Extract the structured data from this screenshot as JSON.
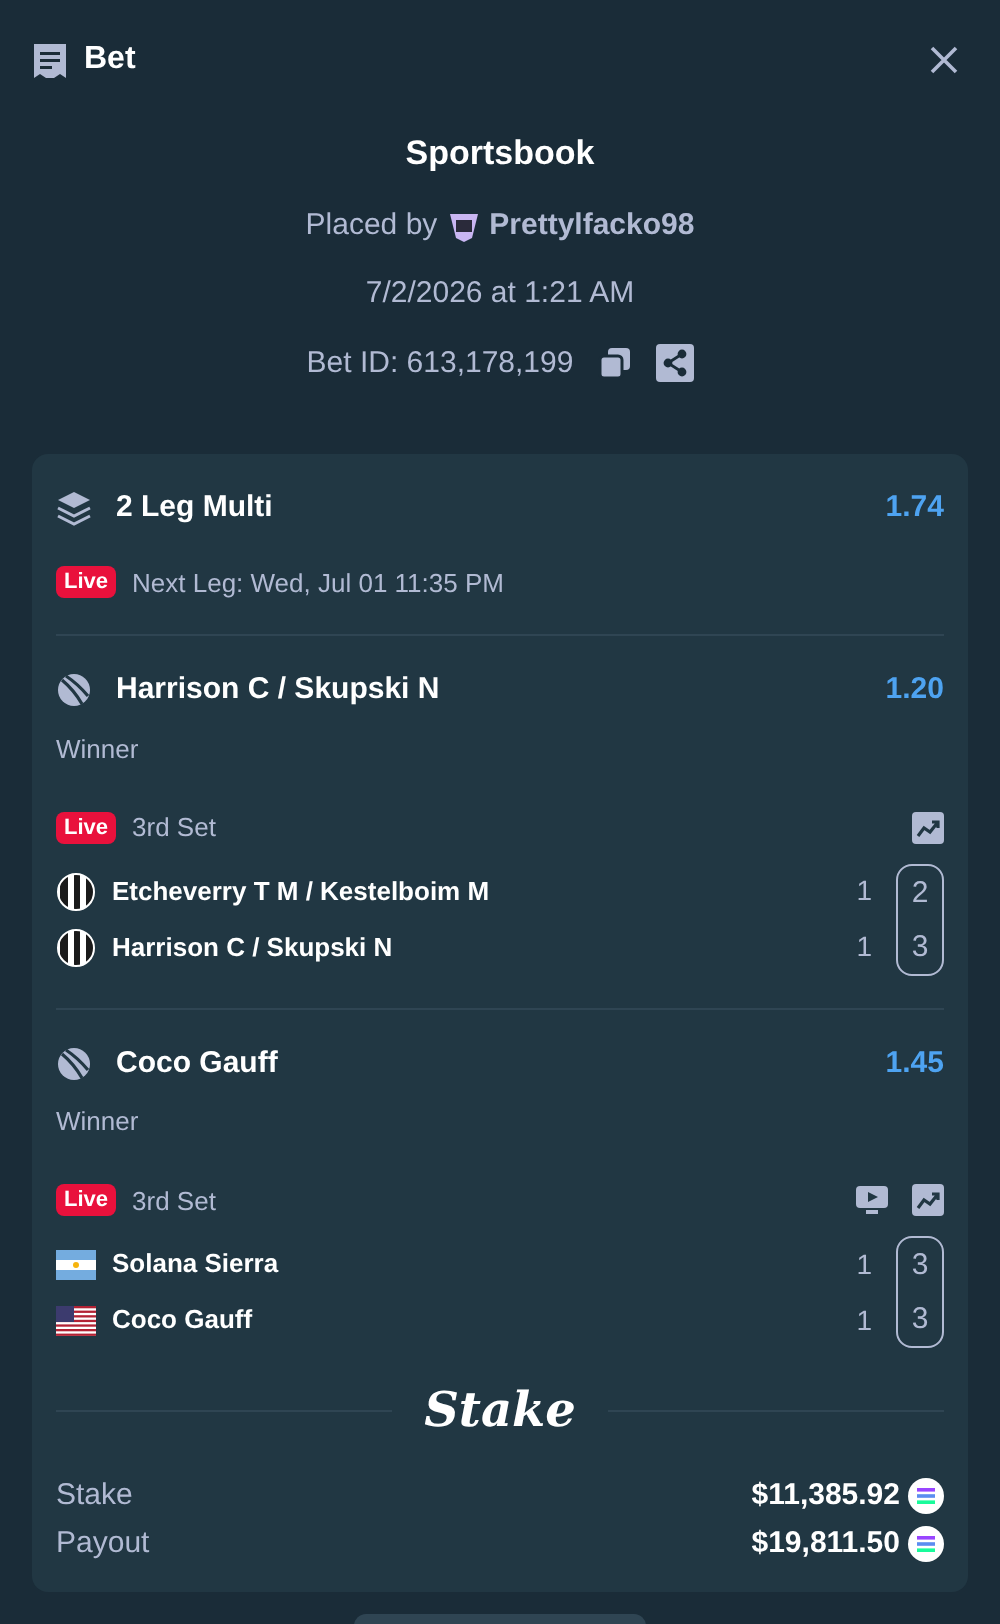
{
  "header": {
    "title": "Bet"
  },
  "summary": {
    "source": "Sportsbook",
    "placed_by_label": "Placed by",
    "user": "Prettylfacko98",
    "date": "7/2/2026 at 1:21 AM",
    "bet_id": "Bet ID: 613,178,199"
  },
  "multi": {
    "title": "2 Leg Multi",
    "odds": "1.74",
    "live_badge": "Live",
    "next_leg": "Next Leg: Wed, Jul 01 11:35 PM"
  },
  "legs": [
    {
      "title": "Harrison C / Skupski N",
      "odds": "1.20",
      "market": "Winner",
      "live_badge": "Live",
      "period": "3rd Set",
      "stream": false,
      "stats": true,
      "players": [
        {
          "name": "Etcheverry T M / Kestelboim M",
          "kind": "stripes",
          "set_score": "1",
          "current": "2"
        },
        {
          "name": "Harrison C / Skupski N",
          "kind": "stripes",
          "set_score": "1",
          "current": "3"
        }
      ]
    },
    {
      "title": "Coco Gauff",
      "odds": "1.45",
      "market": "Winner",
      "live_badge": "Live",
      "period": "3rd Set",
      "stream": true,
      "stats": true,
      "players": [
        {
          "name": "Solana Sierra",
          "kind": "argentina",
          "set_score": "1",
          "current": "3"
        },
        {
          "name": "Coco Gauff",
          "kind": "usa",
          "set_score": "1",
          "current": "3"
        }
      ]
    }
  ],
  "brand": "Stake",
  "totals": [
    {
      "label": "Stake",
      "amount": "$11,385.92"
    },
    {
      "label": "Payout",
      "amount": "$19,811.50"
    }
  ]
}
